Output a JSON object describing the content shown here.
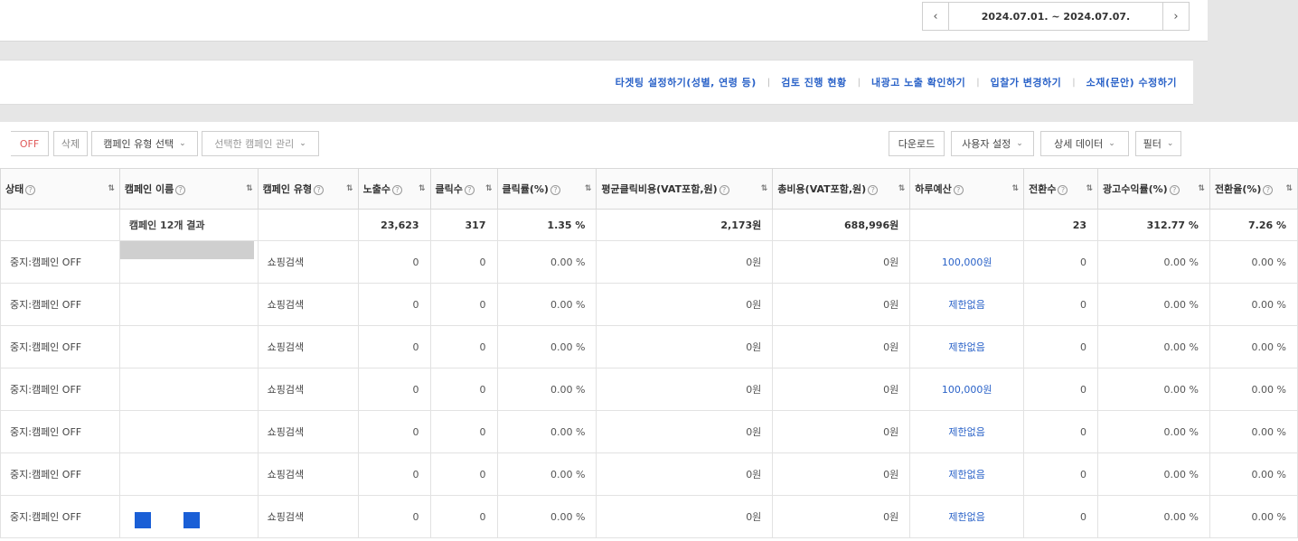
{
  "date": {
    "prev_icon": "chevron-left-icon",
    "range": "2024.07.01. ~ 2024.07.07.",
    "next_icon": "chevron-right-icon"
  },
  "links": [
    "타겟팅 설정하기(성별, 연령 등)",
    "검토 진행 현황",
    "내광고 노출 확인하기",
    "입찰가 변경하기",
    "소재(문안) 수정하기"
  ],
  "toolbar": {
    "off_label": "OFF",
    "delete_label": "삭제",
    "type_select": "캠페인 유형 선택",
    "manage_select": "선택한 캠페인 관리",
    "download_label": "다운로드",
    "user_settings": "사용자 설정",
    "detail_data": "상세 데이터",
    "filter": "필터"
  },
  "columns": [
    "상태",
    "캠페인 이름",
    "캠페인 유형",
    "노출수",
    "클릭수",
    "클릭률(%)",
    "평균클릭비용(VAT포함,원)",
    "총비용(VAT포함,원)",
    "하루예산",
    "전환수",
    "광고수익률(%)",
    "전환율(%)"
  ],
  "summary": {
    "label": "캠페인 12개 결과",
    "impressions": "23,623",
    "clicks": "317",
    "ctr": "1.35 %",
    "cpc": "2,173원",
    "cost": "688,996원",
    "conversions": "23",
    "roas": "312.77 %",
    "cvr": "7.26 %"
  },
  "rows": [
    {
      "status": "중지:캠페인 OFF",
      "type": "쇼핑검색",
      "impressions": "0",
      "clicks": "0",
      "ctr": "0.00 %",
      "cpc": "0원",
      "cost": "0원",
      "budget": "100,000원",
      "conversions": "0",
      "roas": "0.00 %",
      "cvr": "0.00 %"
    },
    {
      "status": "중지:캠페인 OFF",
      "type": "쇼핑검색",
      "impressions": "0",
      "clicks": "0",
      "ctr": "0.00 %",
      "cpc": "0원",
      "cost": "0원",
      "budget": "제한없음",
      "conversions": "0",
      "roas": "0.00 %",
      "cvr": "0.00 %"
    },
    {
      "status": "중지:캠페인 OFF",
      "type": "쇼핑검색",
      "impressions": "0",
      "clicks": "0",
      "ctr": "0.00 %",
      "cpc": "0원",
      "cost": "0원",
      "budget": "제한없음",
      "conversions": "0",
      "roas": "0.00 %",
      "cvr": "0.00 %"
    },
    {
      "status": "중지:캠페인 OFF",
      "type": "쇼핑검색",
      "impressions": "0",
      "clicks": "0",
      "ctr": "0.00 %",
      "cpc": "0원",
      "cost": "0원",
      "budget": "100,000원",
      "conversions": "0",
      "roas": "0.00 %",
      "cvr": "0.00 %"
    },
    {
      "status": "중지:캠페인 OFF",
      "type": "쇼핑검색",
      "impressions": "0",
      "clicks": "0",
      "ctr": "0.00 %",
      "cpc": "0원",
      "cost": "0원",
      "budget": "제한없음",
      "conversions": "0",
      "roas": "0.00 %",
      "cvr": "0.00 %"
    },
    {
      "status": "중지:캠페인 OFF",
      "type": "쇼핑검색",
      "impressions": "0",
      "clicks": "0",
      "ctr": "0.00 %",
      "cpc": "0원",
      "cost": "0원",
      "budget": "제한없음",
      "conversions": "0",
      "roas": "0.00 %",
      "cvr": "0.00 %"
    },
    {
      "status": "중지:캠페인 OFF",
      "type": "쇼핑검색",
      "impressions": "0",
      "clicks": "0",
      "ctr": "0.00 %",
      "cpc": "0원",
      "cost": "0원",
      "budget": "제한없음",
      "conversions": "0",
      "roas": "0.00 %",
      "cvr": "0.00 %"
    }
  ],
  "colors": {
    "link": "#2a62c8",
    "off": "#e05a5a",
    "redaction_blue": "#1a5fd6"
  }
}
